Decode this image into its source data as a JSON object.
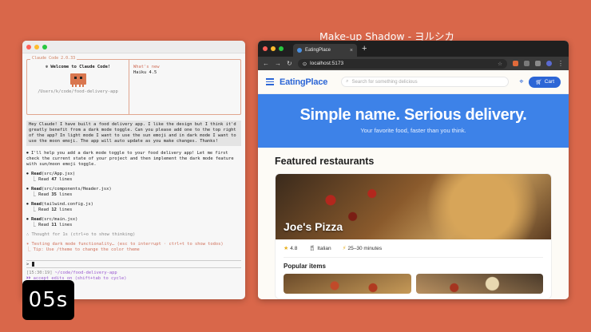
{
  "caption": "Make-up Shadow - ヨルシカ",
  "timer": "05s",
  "terminal": {
    "box_title": "Claude Code 2.0.33",
    "welcome": "✻ Welcome to Claude Code!",
    "cwd": "/Users/k/code/food-delivery-app",
    "whats_new_title": "What's new",
    "whats_new_line": "Haiku 4.5",
    "user_message": "Hey Claude! I have built a food delivery app. I like the design but I think it'd greatly benefit from a dark mode toggle. Can you please add one to the top right of the app? In light mode I want to use the sun emoji and in dark mode I want to use the moon emoji. The app will auto update as you make changes. Thanks!",
    "reply": "⏺ I'll help you add a dark mode toggle to your food delivery app! Let me first check the current state of your project and then implement the dark mode feature with sun/moon emoji toggle.",
    "reads": [
      {
        "verb": "Read",
        "target": "(src/App.jsx)",
        "result_prefix": "⎿ Read ",
        "count": "47",
        "unit": " lines"
      },
      {
        "verb": "Read",
        "target": "(src/components/Header.jsx)",
        "result_prefix": "⎿ Read ",
        "count": "35",
        "unit": " lines"
      },
      {
        "verb": "Read",
        "target": "(tailwind.config.js)",
        "result_prefix": "⎿ Read ",
        "count": "12",
        "unit": " lines"
      },
      {
        "verb": "Read",
        "target": "(src/main.jsx)",
        "result_prefix": "⎿ Read ",
        "count": "11",
        "unit": " lines"
      }
    ],
    "thought": "∴ Thought for 1s (ctrl+o to show thinking)",
    "working": "✶ Testing dark mode functionality… (esc to interrupt · ctrl+t to show todos)",
    "tip": "⎿ Tip: Use /theme to change the color theme",
    "prompt_symbol": ">",
    "status_time": "[15:30:19]",
    "status_path": "~/code/food-delivery-app",
    "status_mode": "⏵⏵ accept edits on (shift+tab to cycle)"
  },
  "browser": {
    "tab_title": "EatingPlace",
    "tab_close": "×",
    "new_tab": "+",
    "url": "localhost:5173",
    "app": {
      "logo": "EatingPlace",
      "search_placeholder": "Search for something delicious",
      "cart_label": "Cart",
      "hero_title": "Simple name. Serious delivery.",
      "hero_subtitle": "Your favorite food, faster than you think.",
      "featured_title": "Featured restaurants",
      "restaurant": {
        "name": "Joe's Pizza",
        "rating": "4.8",
        "cuisine": "Italian",
        "time": "25–30 minutes"
      },
      "popular_title": "Popular items"
    }
  },
  "colors": {
    "background": "#d9674a",
    "brand_blue": "#2c66d6",
    "hero_blue": "#3d82e8"
  }
}
